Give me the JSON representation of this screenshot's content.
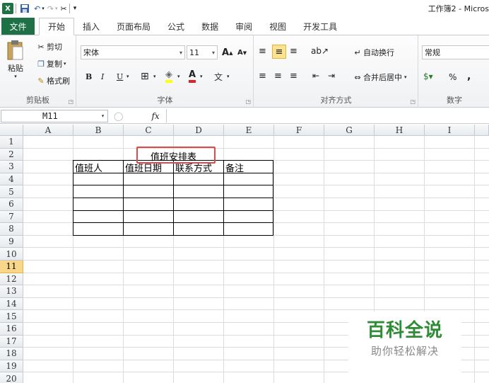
{
  "title_bar": {
    "document_title": "工作簿2 - Micros"
  },
  "tabs": [
    {
      "label": "文件"
    },
    {
      "label": "开始"
    },
    {
      "label": "插入"
    },
    {
      "label": "页面布局"
    },
    {
      "label": "公式"
    },
    {
      "label": "数据"
    },
    {
      "label": "审阅"
    },
    {
      "label": "视图"
    },
    {
      "label": "开发工具"
    }
  ],
  "ribbon": {
    "clipboard": {
      "paste": "粘贴",
      "cut": "剪切",
      "copy": "复制",
      "format_painter": "格式刷",
      "label": "剪贴板"
    },
    "font": {
      "family": "宋体",
      "size": "11",
      "bold": "B",
      "italic": "I",
      "underline": "U",
      "label": "字体"
    },
    "alignment": {
      "wrap": "自动换行",
      "merge": "合并后居中",
      "label": "对齐方式"
    },
    "number": {
      "format": "常规",
      "percent": "%",
      "comma": ",",
      "label": "数字"
    }
  },
  "formula_bar": {
    "name_box": "M11",
    "fx": "fx",
    "content": ""
  },
  "columns": [
    "A",
    "B",
    "C",
    "D",
    "E",
    "F",
    "G",
    "H",
    "I"
  ],
  "rows": [
    "1",
    "2",
    "3",
    "4",
    "5",
    "6",
    "7",
    "8",
    "9",
    "10",
    "11",
    "12",
    "13",
    "14",
    "15",
    "16",
    "17",
    "18",
    "19",
    "20"
  ],
  "active_row": "11",
  "sheet": {
    "title": "值班安排表",
    "headers": [
      "值班人",
      "值班日期",
      "联系方式",
      "备注"
    ]
  },
  "watermark": {
    "line1": "百科全说",
    "line2": "助你轻松解决"
  },
  "colors": {
    "accent": "#1e7145",
    "highlight": "#e0494b",
    "watermark_green": "#2d8c35"
  }
}
